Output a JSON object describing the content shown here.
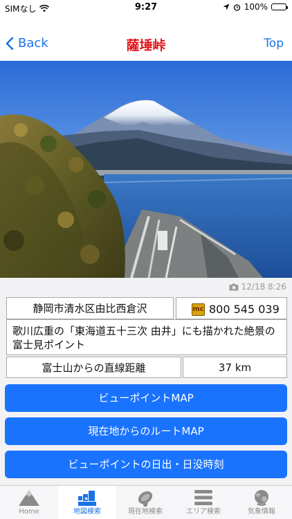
{
  "status_bar": {
    "carrier": "SIMなし",
    "time": "9:27",
    "battery": "100%"
  },
  "nav": {
    "back_label": "Back",
    "title": "薩埵峠",
    "top_label": "Top"
  },
  "photo": {
    "timestamp": "12/18 8:26"
  },
  "info": {
    "address": "静岡市清水区由比西倉沢",
    "mapcode_badge": "mc",
    "mapcode": "800 545 039",
    "description": "歌川広重の「東海道五十三次 由井」にも描かれた絶景の富士見ポイント",
    "distance_label": "富士山からの直線距離",
    "distance_value": "37 km"
  },
  "buttons": {
    "viewpoint_map": "ビューポイントMAP",
    "route_map": "現在地からのルートMAP",
    "sunrise_sunset": "ビューポイントの日出・日没時刻"
  },
  "tabs": [
    {
      "label": "Home",
      "icon": "mountain-icon"
    },
    {
      "label": "地図検索",
      "icon": "map-search-icon",
      "active": true
    },
    {
      "label": "現在地検索",
      "icon": "satellite-dish-icon"
    },
    {
      "label": "エリア検索",
      "icon": "list-lines-icon"
    },
    {
      "label": "気象情報",
      "icon": "weather-icon"
    }
  ],
  "colors": {
    "accent": "#1a73e8",
    "title": "#e0141b",
    "button": "#1a73ff"
  }
}
